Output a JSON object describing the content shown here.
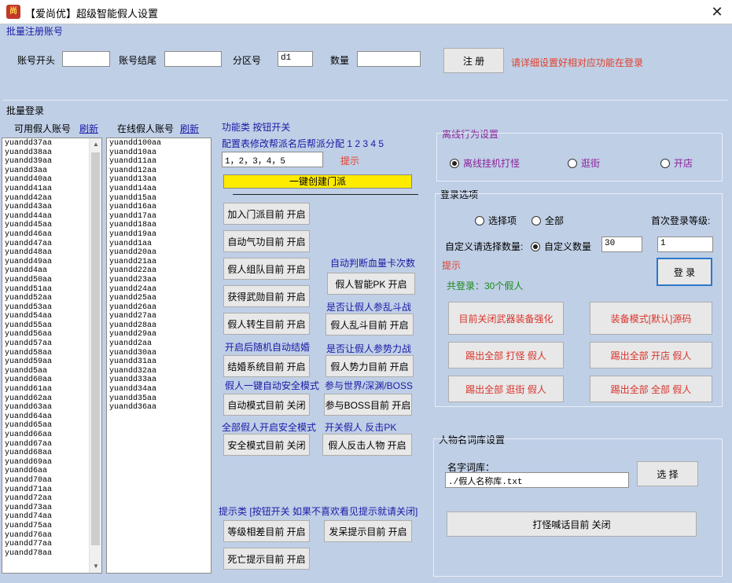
{
  "window": {
    "title": "【爱尚优】超级智能假人设置",
    "close_glyph": "✕",
    "icon_text": "尚"
  },
  "batch_register": {
    "section_label": "批量注册账号",
    "account_start_label": "账号开头",
    "account_start_value": "",
    "account_end_label": "账号结尾",
    "account_end_value": "",
    "zone_label": "分区号",
    "zone_value": "d1",
    "count_label": "数量",
    "count_value": "",
    "register_button": "注  册",
    "hint": "请详细设置好相对应功能在登录"
  },
  "batch_login": {
    "section_label": "批量登录",
    "available_label": "可用假人账号",
    "available_refresh": "刷新",
    "online_label": "在线假人账号",
    "online_refresh": "刷新",
    "available_accounts": [
      "yuandd37aa",
      "yuandd38aa",
      "yuandd39aa",
      "yuandd3aa",
      "yuandd40aa",
      "yuandd41aa",
      "yuandd42aa",
      "yuandd43aa",
      "yuandd44aa",
      "yuandd45aa",
      "yuandd46aa",
      "yuandd47aa",
      "yuandd48aa",
      "yuandd49aa",
      "yuandd4aa",
      "yuandd50aa",
      "yuandd51aa",
      "yuandd52aa",
      "yuandd53aa",
      "yuandd54aa",
      "yuandd55aa",
      "yuandd56aa",
      "yuandd57aa",
      "yuandd58aa",
      "yuandd59aa",
      "yuandd5aa",
      "yuandd60aa",
      "yuandd61aa",
      "yuandd62aa",
      "yuandd63aa",
      "yuandd64aa",
      "yuandd65aa",
      "yuandd66aa",
      "yuandd67aa",
      "yuandd68aa",
      "yuandd69aa",
      "yuandd6aa",
      "yuandd70aa",
      "yuandd71aa",
      "yuandd72aa",
      "yuandd73aa",
      "yuandd74aa",
      "yuandd75aa",
      "yuandd76aa",
      "yuandd77aa",
      "yuandd78aa"
    ],
    "online_accounts": [
      "yuandd100aa",
      "yuandd10aa",
      "yuandd11aa",
      "yuandd12aa",
      "yuandd13aa",
      "yuandd14aa",
      "yuandd15aa",
      "yuandd16aa",
      "yuandd17aa",
      "yuandd18aa",
      "yuandd19aa",
      "yuandd1aa",
      "yuandd20aa",
      "yuandd21aa",
      "yuandd22aa",
      "yuandd23aa",
      "yuandd24aa",
      "yuandd25aa",
      "yuandd26aa",
      "yuandd27aa",
      "yuandd28aa",
      "yuandd29aa",
      "yuandd2aa",
      "yuandd30aa",
      "yuandd31aa",
      "yuandd32aa",
      "yuandd33aa",
      "yuandd34aa",
      "yuandd35aa",
      "yuandd36aa"
    ]
  },
  "functions": {
    "header": "功能类 按钮开关",
    "config_label": "配置表修改帮派名后帮派分配 1 2 3 4 5",
    "config_value": "1，2，3，4，5",
    "config_hint": "提示",
    "create_sect_button": "一键创建门派",
    "join_sect": "加入门派目前 开启",
    "auto_qigong": "自动气功目前 开启",
    "team": "假人组队目前 开启",
    "merit": "获得武勋目前 开启",
    "reincarnate": "假人转生目前 开启",
    "marriage_label": "开启后随机自动结婚",
    "marriage": "结婚系统目前 开启",
    "safe_mode_label": "假人一键自动安全模式",
    "auto_mode": "自动模式目前 关闭",
    "all_safe_label": "全部假人开启安全模式",
    "safe_mode": "安全模式目前 关闭",
    "smart_pk_label": "自动判断血量卡次数",
    "smart_pk": "假人智能PK 开启",
    "brawl_label": "是否让假人参乱斗战",
    "brawl": "假人乱斗目前 开启",
    "faction_label": "是否让假人参势力战",
    "faction": "假人势力目前 开启",
    "boss_label": "参与世界/深渊/BOSS",
    "boss": "参与BOSS目前 开启",
    "counter_label": "开关假人 反击PK",
    "counter": "假人反击人物 开启"
  },
  "tips": {
    "header": "提示类 [按钮开关 如果不喜欢看见提示就请关闭]",
    "level_gap": "等级相差目前 开启",
    "afk_tip": "发呆提示目前 开启",
    "death_tip": "死亡提示目前 开启"
  },
  "offline": {
    "section_label": "离线行为设置",
    "options": [
      "离线挂机打怪",
      "逛街",
      "开店"
    ],
    "selected": "离线挂机打怪"
  },
  "login_options": {
    "section_label": "登录选项",
    "opt_select": "选择项",
    "opt_all": "全部",
    "first_level_label": "首次登录等级:",
    "custom_count_label": "自定义请选择数量:",
    "opt_custom": "自定义数量",
    "custom_count_value": "30",
    "first_level_value": "1",
    "hint": "提示",
    "total_login": "共登录：30个假人",
    "login_button": "登 录",
    "btn_weapon_enhance": "目前关闭武器装备强化",
    "btn_equip_mode": "装备模式[默认]源码",
    "btn_kick_fight": "踢出全部 打怪 假人",
    "btn_kick_shop": "踢出全部 开店 假人",
    "btn_kick_stroll": "踢出全部 逛街 假人",
    "btn_kick_all": "踢出全部 全部 假人"
  },
  "names": {
    "section_label": "人物名词库设置",
    "dict_label": "名字词库：",
    "dict_value": "./假人名称库.txt",
    "select_button": "选 择",
    "shout_button": "打怪喊话目前 关闭"
  },
  "colors": {
    "background": "#bfcfe6",
    "accent_blue": "#1a1aa6",
    "hint_red": "#e0402c",
    "ok_green": "#1a8a1a",
    "section_purple": "#8c1f9a",
    "highlight_yellow": "#ffeb00"
  }
}
